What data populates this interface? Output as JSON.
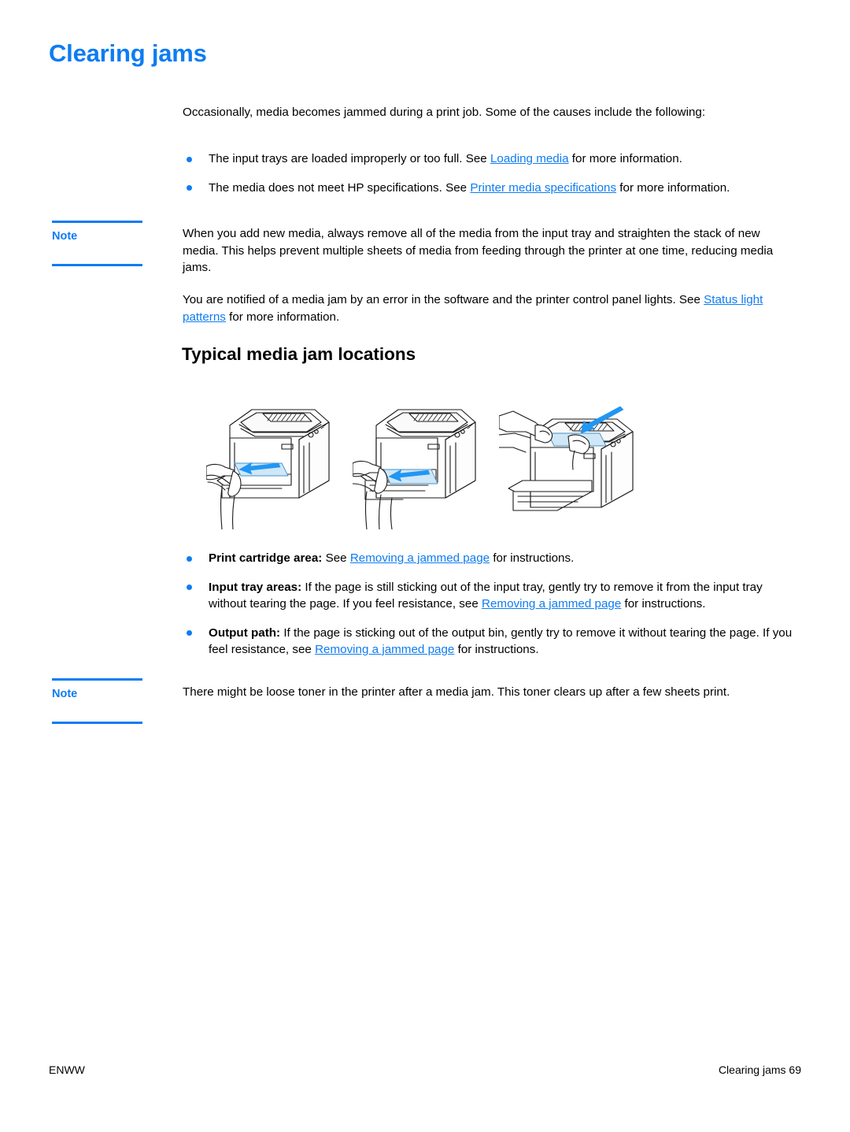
{
  "document": {
    "chapter_title": "Clearing jams",
    "footer": {
      "left": "ENWW",
      "right": "Clearing jams 69"
    },
    "accent_color": "#0d7cf2",
    "link_color": "#0d7cf2"
  },
  "intro": {
    "paragraph": "Occasionally, media becomes jammed during a print job. Some of the causes include the following:",
    "bullets": [
      {
        "pre": "The input trays are loaded improperly or too full. See ",
        "link": "Loading media",
        "post": " for more information."
      },
      {
        "pre": "The media does not meet HP specifications. See ",
        "link": "Printer media specifications",
        "post": " for more information."
      }
    ]
  },
  "note_one": {
    "label": "Note",
    "text": "When you add new media, always remove all of the media from the input tray and straighten the stack of new media. This helps prevent multiple sheets of media from feeding through the printer at one time, reducing media jams."
  },
  "notify": {
    "pre": "You are notified of a media jam by an error in the software and the printer control panel lights. See ",
    "link": "Status light patterns",
    "post": " for more information."
  },
  "section": {
    "heading": "Typical media jam locations"
  },
  "illustrations": [
    {
      "name": "printer-input-tray-jam-front",
      "caption_ref": "Print cartridge area"
    },
    {
      "name": "printer-input-tray-jam-priority",
      "caption_ref": "Input tray areas"
    },
    {
      "name": "printer-output-bin-jam",
      "caption_ref": "Output path"
    }
  ],
  "locations": {
    "bullets": [
      {
        "lead": "Print cartridge area:",
        "pre": " See ",
        "link": "Removing a jammed page",
        "post": " for instructions."
      },
      {
        "lead": "Input tray areas:",
        "pre": " If the page is still sticking out of the input tray, gently try to remove it from the input tray without tearing the page. If you feel resistance, see ",
        "link": "Removing a jammed page",
        "post": " for instructions."
      },
      {
        "lead": "Output path:",
        "pre": " If the page is sticking out of the output bin, gently try to remove it without tearing the page. If you feel resistance, see ",
        "link": "Removing a jammed page",
        "post": " for instructions."
      }
    ]
  },
  "note_two": {
    "label": "Note",
    "text": "There might be loose toner in the printer after a media jam. This toner clears up after a few sheets print."
  }
}
